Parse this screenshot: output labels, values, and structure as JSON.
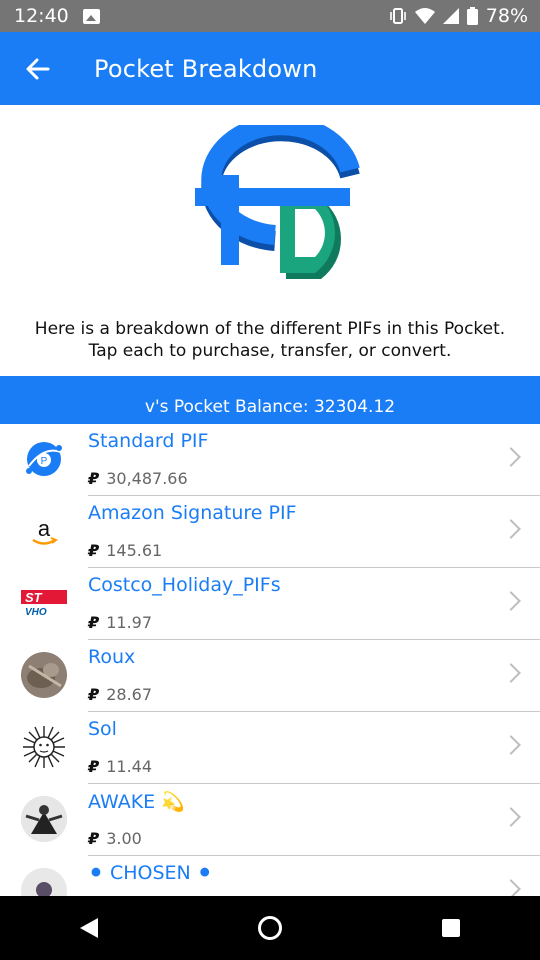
{
  "status_bar": {
    "time": "12:40",
    "battery": "78%",
    "icons": [
      "image-icon",
      "vibrate-icon",
      "wifi-icon",
      "signal-icon",
      "battery-icon"
    ]
  },
  "app_bar": {
    "title": "Pocket Breakdown",
    "back_icon": "arrow-left-icon"
  },
  "intro": {
    "line1": "Here is a breakdown of the different PIFs in this Pocket.",
    "line2": "Tap each to purchase, transfer, or convert."
  },
  "balance": {
    "text": "v's Pocket Balance: 32304.12"
  },
  "items": [
    {
      "name": "Standard PIF",
      "amount": "30,487.66",
      "avatar": "globe-pif-icon"
    },
    {
      "name": "Amazon Signature PIF",
      "amount": "145.61",
      "avatar": "amazon-logo"
    },
    {
      "name": "Costco_Holiday_PIFs",
      "amount": "11.97",
      "avatar": "costco-logo"
    },
    {
      "name": "Roux",
      "amount": "28.67",
      "avatar": "cat-photo"
    },
    {
      "name": "Sol",
      "amount": "11.44",
      "avatar": "sun-engraving"
    },
    {
      "name": "AWAKE 💫",
      "amount": "3.00",
      "avatar": "person-photo"
    },
    {
      "name": "⚫ CHOSEN ⚫",
      "amount": "",
      "avatar": "person-photo-2"
    }
  ],
  "currency_symbol": "₽",
  "colors": {
    "primary": "#1a7df5",
    "status_bar": "#757575",
    "logo_blue": "#1a7df5",
    "logo_green": "#1aa57f"
  },
  "nav_bar": {
    "icons": [
      "back-triangle-icon",
      "home-circle-icon",
      "recents-square-icon"
    ]
  }
}
